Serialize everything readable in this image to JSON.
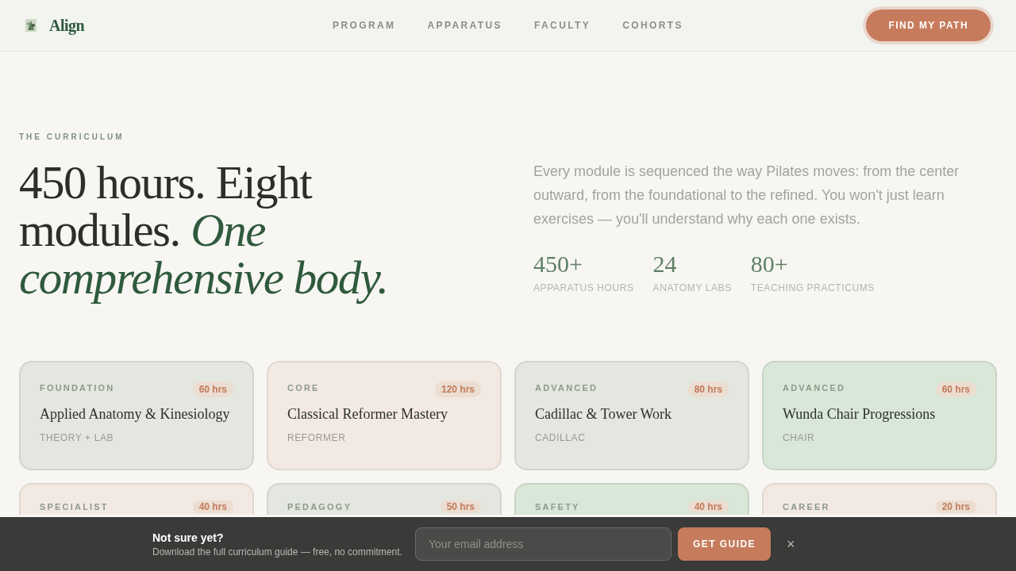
{
  "header": {
    "brand": "Align",
    "nav": [
      {
        "label": "PROGRAM",
        "selected": false
      },
      {
        "label": "APPARATUS",
        "selected": false
      },
      {
        "label": "FACULTY",
        "selected": false
      },
      {
        "label": "COHORTS",
        "selected": false
      }
    ],
    "cta": "FIND MY PATH"
  },
  "hero": {
    "eyebrow": "THE CURRICULUM",
    "heading": "450 hours. Eight modules.",
    "heading_accent": "One comprehensive body.",
    "intro": "Every module is sequenced the way Pilates moves: from the center outward, from the foundational to the refined. You won't just learn exercises — you'll understand why each one exists.",
    "stats": [
      {
        "value": "450+",
        "label": "APPARATUS HOURS"
      },
      {
        "value": "24",
        "label": "ANATOMY LABS"
      },
      {
        "value": "80+",
        "label": "TEACHING PRACTICUMS"
      }
    ]
  },
  "modules": [
    {
      "category": "FOUNDATION",
      "hours": "60 hrs",
      "title": "Applied Anatomy & Kinesiology",
      "apparatus": "THEORY + LAB",
      "color": "#e4e6e0"
    },
    {
      "category": "CORE",
      "hours": "120 hrs",
      "title": "Classical Reformer Mastery",
      "apparatus": "REFORMER",
      "color": "#f3e9e3"
    },
    {
      "category": "ADVANCED",
      "hours": "80 hrs",
      "title": "Cadillac & Tower Work",
      "apparatus": "CADILLAC",
      "color": "#e4e6e0"
    },
    {
      "category": "ADVANCED",
      "hours": "60 hrs",
      "title": "Wunda Chair Progressions",
      "apparatus": "CHAIR",
      "color": "#d8e7d8"
    },
    {
      "category": "SPECIALIST",
      "hours": "40 hrs",
      "color": "#f3e9e3"
    },
    {
      "category": "PEDAGOGY",
      "hours": "50 hrs",
      "color": "#e4e6e0"
    },
    {
      "category": "SAFETY",
      "hours": "40 hrs",
      "color": "#d8e7d8"
    },
    {
      "category": "CAREER",
      "hours": "20 hrs",
      "color": "#f3e9e3"
    }
  ],
  "banner": {
    "title": "Not sure yet?",
    "subtitle": "Download the full curriculum guide — free, no commitment.",
    "email_placeholder": "Your email address",
    "button": "GET GUIDE",
    "close": "×"
  }
}
